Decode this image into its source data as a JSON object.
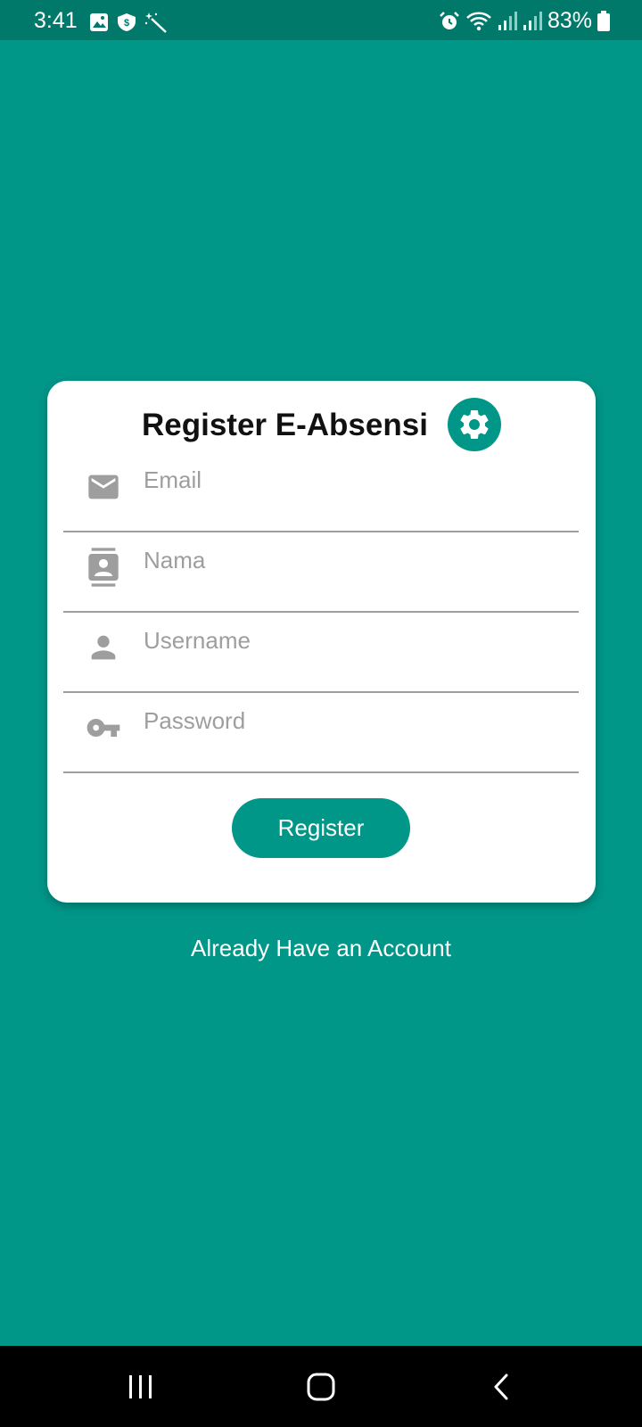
{
  "status_bar": {
    "time": "3:41",
    "battery": "83%",
    "left_icons": [
      "image-icon",
      "shield-dollar-icon",
      "magic-wand-icon"
    ],
    "right_icons": [
      "alarm-icon",
      "wifi-icon",
      "signal-icon",
      "signal-icon",
      "battery-icon"
    ]
  },
  "card": {
    "title": "Register E-Absensi",
    "settings_icon": "gear-icon",
    "fields": [
      {
        "placeholder": "Email",
        "value": "",
        "icon": "email-icon"
      },
      {
        "placeholder": "Nama",
        "value": "",
        "icon": "contact-card-icon"
      },
      {
        "placeholder": "Username",
        "value": "",
        "icon": "person-icon"
      },
      {
        "placeholder": "Password",
        "value": "",
        "icon": "key-icon"
      }
    ],
    "register_label": "Register"
  },
  "login_link": "Already Have an Account",
  "colors": {
    "primary": "#009688",
    "status_bar": "#00796b",
    "icon_gray": "#9e9e9e",
    "card": "#ffffff"
  },
  "nav": {
    "icons": [
      "recent-apps-icon",
      "home-icon",
      "back-icon"
    ]
  }
}
